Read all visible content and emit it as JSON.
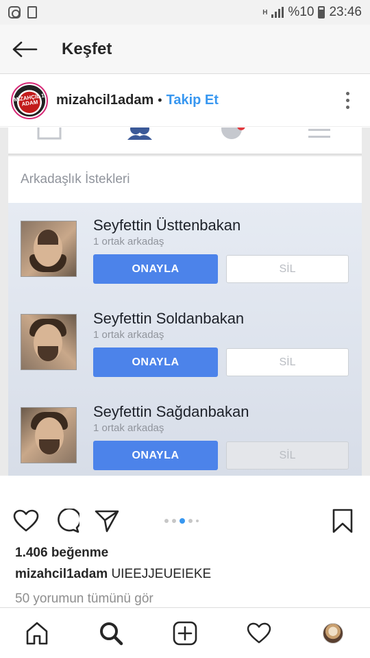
{
  "status_bar": {
    "network_letter": "H",
    "battery": "%10",
    "time": "23:46"
  },
  "header": {
    "title": "Keşfet",
    "back_icon": "arrow-left-icon"
  },
  "post": {
    "author": "mizahcil1adam",
    "separator": "•",
    "follow_label": "Takip Et",
    "avatar_text": "MİZAHÇIL 1 ADAM",
    "more_icon": "more-vertical-icon"
  },
  "screenshot": {
    "section_title": "Arkadaşlık İstekleri",
    "requests": [
      {
        "name": "Seyfettin Üsttenbakan",
        "mutual": "1 ortak arkadaş",
        "confirm": "ONAYLA",
        "delete": "SİL"
      },
      {
        "name": "Seyfettin Soldanbakan",
        "mutual": "1 ortak arkadaş",
        "confirm": "ONAYLA",
        "delete": "SİL"
      },
      {
        "name": "Seyfettin Sağdanbakan",
        "mutual": "1 ortak arkadaş",
        "confirm": "ONAYLA",
        "delete": "SİL"
      }
    ],
    "colors": {
      "confirm_blue": "#4c83ea",
      "list_bg": "#e6ebf3"
    }
  },
  "carousel": {
    "active_index": 2,
    "count": 5
  },
  "engagement": {
    "likes": "1.406 beğenme",
    "caption_user": "mizahcil1adam",
    "caption_text": "UIEEJJEUEIEKE",
    "comments_link": "50 yorumun tümünü gör"
  },
  "bottom_nav": [
    "home-icon",
    "search-icon",
    "add-post-icon",
    "activity-heart-icon",
    "profile-avatar"
  ],
  "accent": "#3897f0"
}
